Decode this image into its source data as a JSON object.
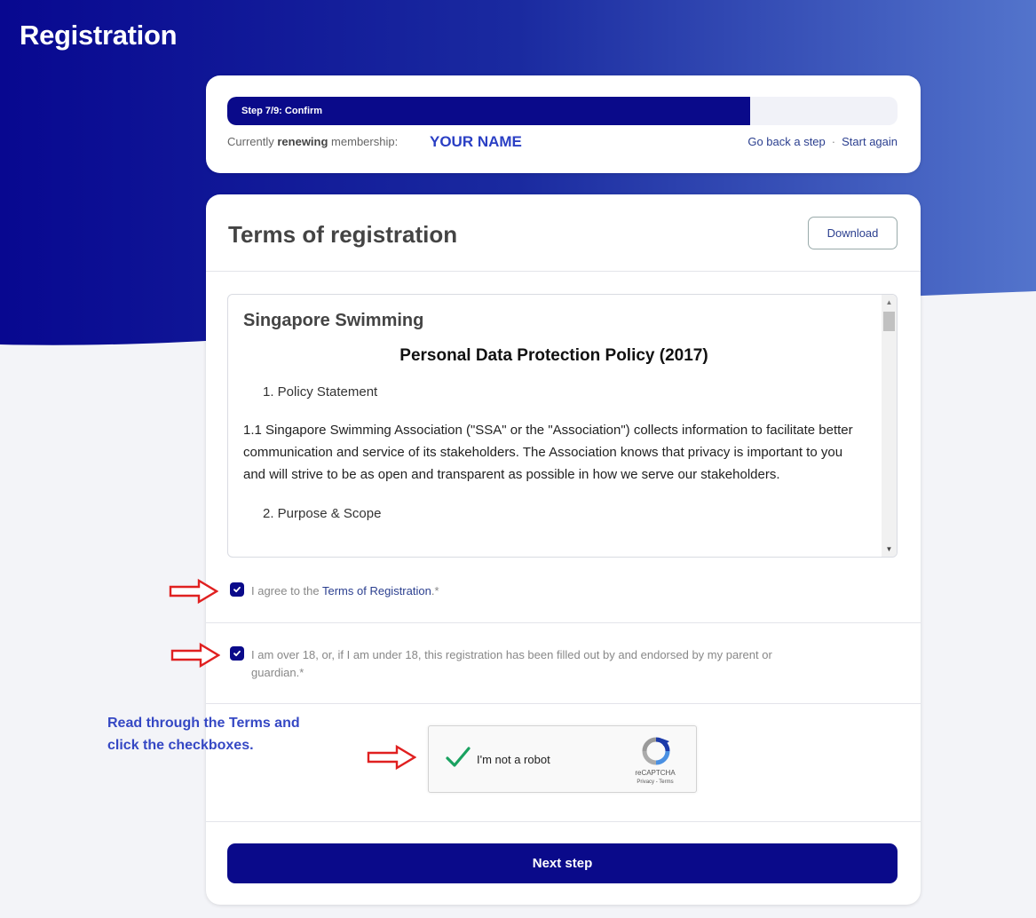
{
  "page": {
    "title": "Registration"
  },
  "colors": {
    "primary": "#0a0a8a",
    "link": "#2b3f8f",
    "annotation": "#3548c4",
    "annotation_arrow": "#e02020"
  },
  "progress": {
    "label": "Step 7/9: Confirm",
    "fraction": 0.78
  },
  "membership": {
    "prefix": "Currently ",
    "action": "renewing",
    "suffix": " membership:",
    "member_name": "YOUR NAME"
  },
  "nav": {
    "back": "Go back a step",
    "separator": "·",
    "restart": "Start again"
  },
  "terms": {
    "title": "Terms of registration",
    "download_label": "Download",
    "document": {
      "org": "Singapore Swimming",
      "policy": "Personal Data Protection Policy (2017)",
      "section1": "1. Policy Statement",
      "para1": "1.1 Singapore Swimming Association (\"SSA\" or the \"Association\") collects information to facilitate better communication and service of its stakeholders. The Association knows that privacy is important to you and will strive to be as open and transparent as possible in how we serve our stakeholders.",
      "section2": "2. Purpose & Scope"
    },
    "scroll_icons": {
      "up": "scroll-up-arrow",
      "down": "scroll-down-arrow"
    }
  },
  "agreements": [
    {
      "checked": true,
      "prefix": "I agree to the ",
      "link": "Terms of Registration",
      "suffix": ".*"
    },
    {
      "checked": true,
      "line1": "I am over 18, or, if I am under 18, this registration has been filled out by and endorsed by my parent or",
      "line2": "guardian.*"
    }
  ],
  "recaptcha": {
    "checked": true,
    "label": "I'm not a robot",
    "brand": "reCAPTCHA",
    "links": "Privacy - Terms"
  },
  "next_button": {
    "label": "Next step"
  },
  "annotation": {
    "line1": "Read through the Terms and",
    "line2": "click the checkboxes."
  }
}
